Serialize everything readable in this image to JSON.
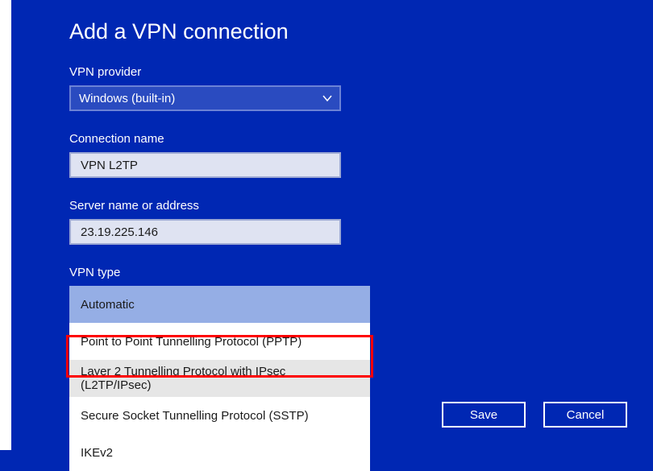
{
  "title": "Add a VPN connection",
  "fields": {
    "provider": {
      "label": "VPN provider",
      "value": "Windows (built-in)"
    },
    "connectionName": {
      "label": "Connection name",
      "value": "VPN L2TP"
    },
    "serverAddress": {
      "label": "Server name or address",
      "value": "23.19.225.146"
    },
    "vpnType": {
      "label": "VPN type",
      "options": [
        "Automatic",
        "Point to Point Tunnelling Protocol (PPTP)",
        "Layer 2 Tunnelling Protocol with IPsec (L2TP/IPsec)",
        "Secure Socket Tunnelling Protocol (SSTP)",
        "IKEv2"
      ],
      "selectedIndex": 0,
      "highlightedIndex": 2
    }
  },
  "buttons": {
    "save": "Save",
    "cancel": "Cancel"
  }
}
